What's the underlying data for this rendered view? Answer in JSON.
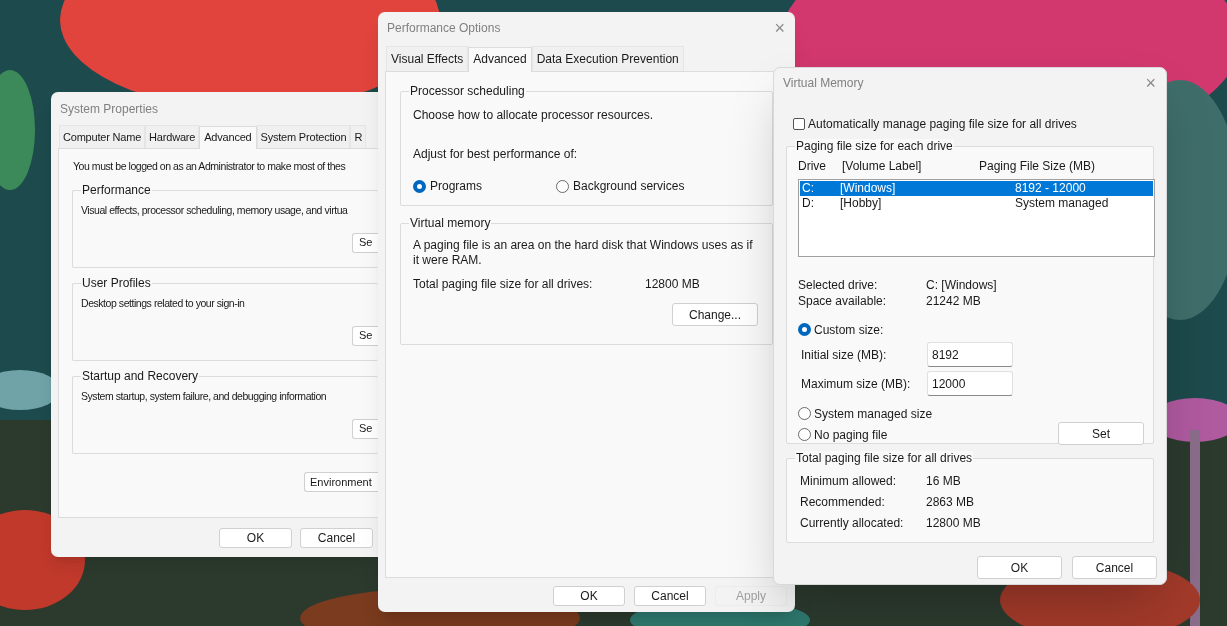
{
  "system_properties": {
    "title": "System Properties",
    "tabs": [
      {
        "label": "Computer Name",
        "selected": false
      },
      {
        "label": "Hardware",
        "selected": false
      },
      {
        "label": "Advanced",
        "selected": true
      },
      {
        "label": "System Protection",
        "selected": false
      },
      {
        "label": "R",
        "selected": false
      }
    ],
    "notice": "You must be logged on as an Administrator to make most of thes",
    "groups": [
      {
        "title": "Performance",
        "description": "Visual effects, processor scheduling, memory usage, and virtua",
        "button": "Se"
      },
      {
        "title": "User Profiles",
        "description": "Desktop settings related to your sign-in",
        "button": "Se"
      },
      {
        "title": "Startup and Recovery",
        "description": "System startup, system failure, and debugging information",
        "button": "Se"
      }
    ],
    "environment_button": "Environment",
    "buttons": [
      "OK",
      "Cancel"
    ]
  },
  "performance_options": {
    "title": "Performance Options",
    "close": "×",
    "tabs": [
      {
        "label": "Visual Effects",
        "selected": false
      },
      {
        "label": "Advanced",
        "selected": true
      },
      {
        "label": "Data Execution Prevention",
        "selected": false
      }
    ],
    "processor_scheduling": {
      "title": "Processor scheduling",
      "description": "Choose how to allocate processor resources.",
      "adjust_label": "Adjust for best performance of:",
      "options": [
        {
          "label": "Programs",
          "selected": true
        },
        {
          "label": "Background services",
          "selected": false
        }
      ]
    },
    "virtual_memory": {
      "title": "Virtual memory",
      "description": "A paging file is an area on the hard disk that Windows uses as if it were RAM.",
      "total_label": "Total paging file size for all drives:",
      "total_value": "12800 MB",
      "button": "Change..."
    },
    "buttons": [
      {
        "label": "OK",
        "disabled": false
      },
      {
        "label": "Cancel",
        "disabled": false
      },
      {
        "label": "Apply",
        "disabled": true
      }
    ]
  },
  "virtual_memory": {
    "title": "Virtual Memory",
    "close": "×",
    "auto_manage": {
      "label": "Automatically manage paging file size for all drives",
      "checked": false
    },
    "drives_group": {
      "title": "Paging file size for each drive",
      "columns": [
        "Drive",
        "[Volume Label]",
        "Paging File Size (MB)"
      ],
      "rows": [
        {
          "drive": "C:",
          "label": "[Windows]",
          "size": "8192 - 12000",
          "selected": true
        },
        {
          "drive": "D:",
          "label": "[Hobby]",
          "size": "System managed",
          "selected": false
        }
      ],
      "info": [
        {
          "label": "Selected drive:",
          "value": "C:  [Windows]"
        },
        {
          "label": "Space available:",
          "value": "21242 MB"
        }
      ],
      "options": [
        {
          "label": "Custom size:",
          "selected": true,
          "fields": [
            {
              "label": "Initial size (MB):",
              "value": "8192"
            },
            {
              "label": "Maximum size (MB):",
              "value": "12000"
            }
          ]
        },
        {
          "label": "System managed size",
          "selected": false
        },
        {
          "label": "No paging file",
          "selected": false
        }
      ],
      "set_button": "Set"
    },
    "totals_group": {
      "title": "Total paging file size for all drives",
      "rows": [
        {
          "label": "Minimum allowed:",
          "value": "16 MB"
        },
        {
          "label": "Recommended:",
          "value": "2863 MB"
        },
        {
          "label": "Currently allocated:",
          "value": "12800 MB"
        }
      ]
    },
    "buttons": [
      "OK",
      "Cancel"
    ]
  }
}
